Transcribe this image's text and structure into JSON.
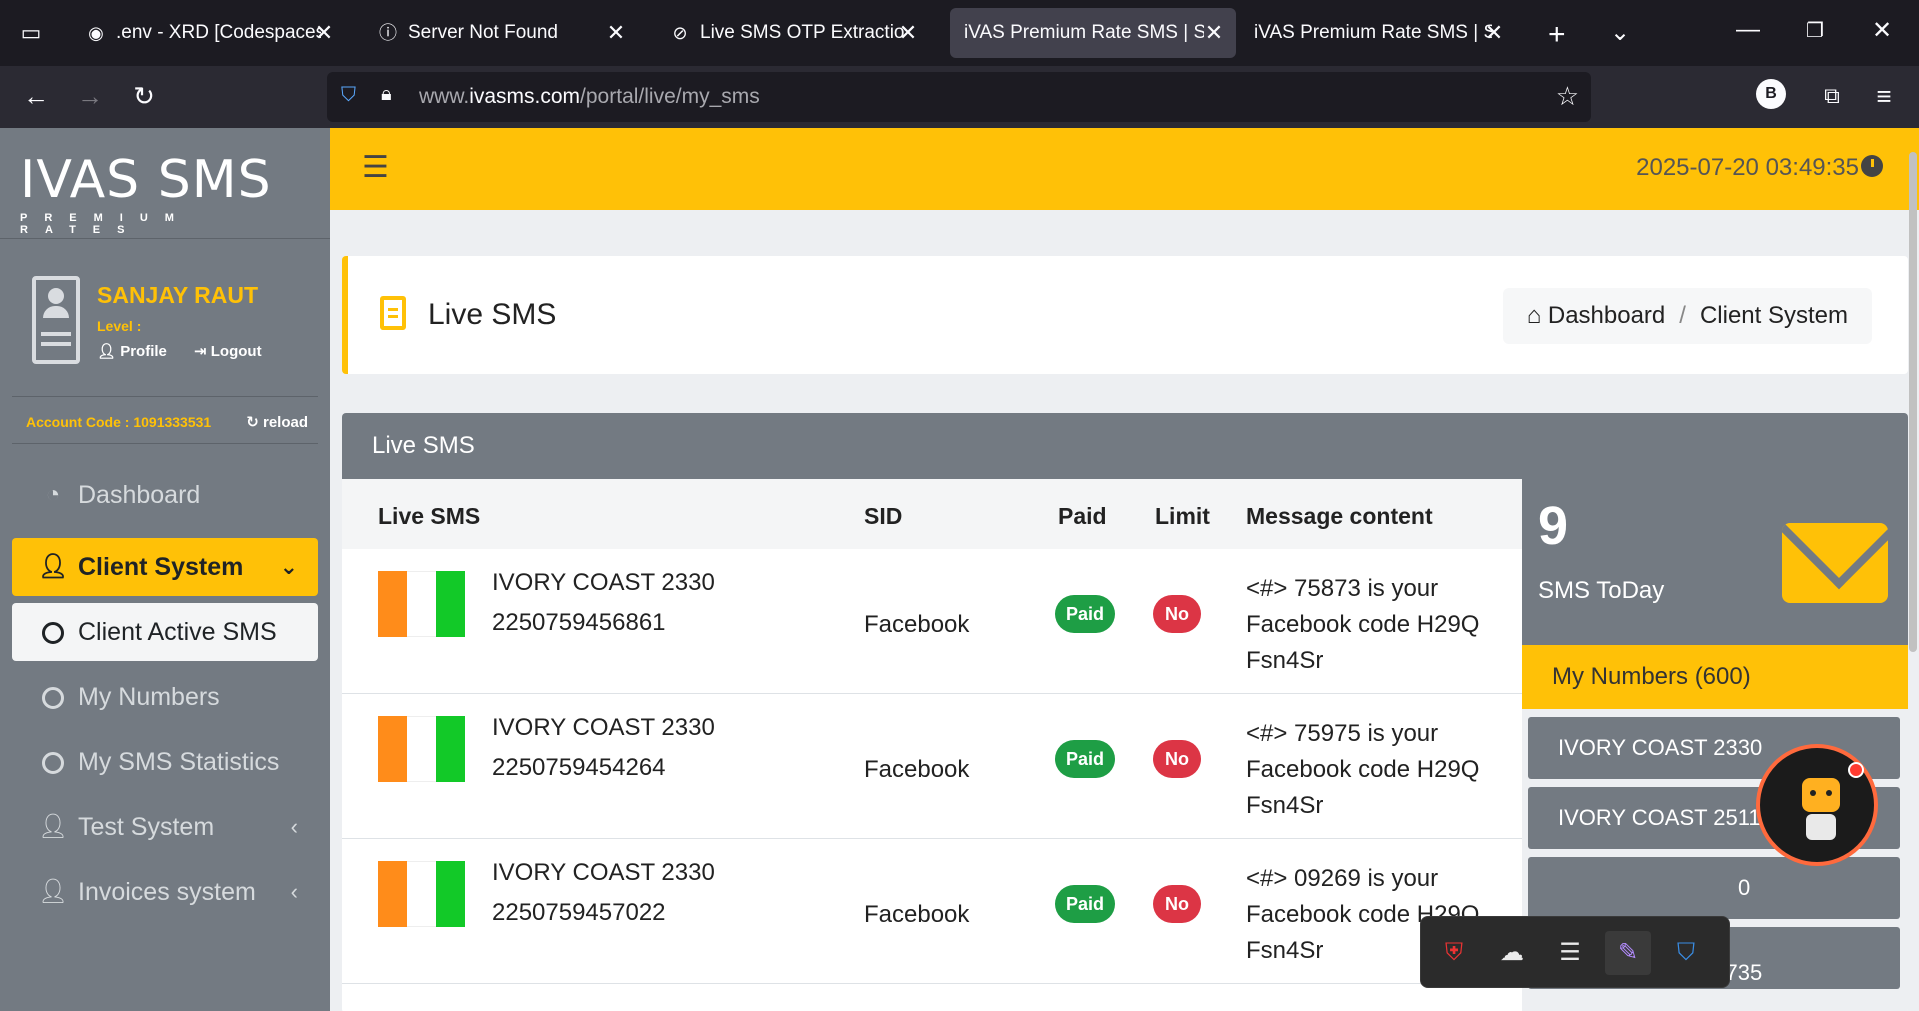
{
  "browser": {
    "tabs": [
      {
        "title": ".env - XRD [Codespaces: le",
        "icon": "github-icon",
        "glyph": "◉",
        "active": false
      },
      {
        "title": "Server Not Found",
        "icon": "info-icon",
        "glyph": "ⓘ",
        "active": false
      },
      {
        "title": "Live SMS OTP Extraction a",
        "icon": "loading-icon",
        "glyph": "⊘",
        "active": false
      },
      {
        "title": "iVAS Premium Rate SMS | SMS",
        "icon": "",
        "glyph": "",
        "active": true
      },
      {
        "title": "iVAS Premium Rate SMS | SMS",
        "icon": "",
        "glyph": "",
        "active": false
      }
    ],
    "url_prefix": "www.",
    "url_domain": "ivasms.com",
    "url_path": "/portal/live/my_sms",
    "profile_letter": "B"
  },
  "sidebar": {
    "logo": "IVAS SMS",
    "logo_sub": "PREMIUM RATES",
    "user_name": "SANJAY RAUT",
    "level_label": "Level :",
    "profile_label": "Profile",
    "logout_label": "Logout",
    "account_code": "Account Code : 1091333531",
    "reload_label": "reload",
    "menu": [
      {
        "label": "Dashboard",
        "icon": "dashboard-icon"
      },
      {
        "label": "Client System",
        "icon": "user-icon",
        "state": "open"
      },
      {
        "label": "Client Active SMS",
        "icon": "circle-icon",
        "state": "selected"
      },
      {
        "label": "My Numbers",
        "icon": "circle-icon"
      },
      {
        "label": "My SMS Statistics",
        "icon": "circle-icon"
      },
      {
        "label": "Test System",
        "icon": "user-icon"
      },
      {
        "label": "Invoices system",
        "icon": "user-icon"
      }
    ]
  },
  "topbar": {
    "datetime": "2025-07-20 03:49:35"
  },
  "header": {
    "title": "Live SMS",
    "breadcrumb_home": "Dashboard",
    "breadcrumb_current": "Client System"
  },
  "main": {
    "card_title": "Live SMS",
    "columns": [
      "Live SMS",
      "SID",
      "Paid",
      "Limit",
      "Message content"
    ],
    "rows": [
      {
        "range": "IVORY COAST 2330",
        "number": "2250759456861",
        "sid": "Facebook",
        "paid": "Paid",
        "limit": "No",
        "message": "<#> 75873 is your Facebook code H29Q Fsn4Sr"
      },
      {
        "range": "IVORY COAST 2330",
        "number": "2250759454264",
        "sid": "Facebook",
        "paid": "Paid",
        "limit": "No",
        "message": "<#> 75975 is your Facebook code H29Q Fsn4Sr"
      },
      {
        "range": "IVORY COAST 2330",
        "number": "2250759457022",
        "sid": "Facebook",
        "paid": "Paid",
        "limit": "No",
        "message": "<#> 09269 is your Facebook code H29Q Fsn4Sr"
      }
    ]
  },
  "stats": {
    "count": "9",
    "label": "SMS ToDay",
    "my_numbers": "My Numbers (600)",
    "number_items": [
      "IVORY COAST 2330",
      "IVORY COAST 2511",
      "0",
      "IVORY COAST 2735"
    ]
  },
  "colors": {
    "accent": "#ffc107",
    "sidebar": "#737a82",
    "paid": "#1e9e45",
    "no": "#dc3545"
  }
}
